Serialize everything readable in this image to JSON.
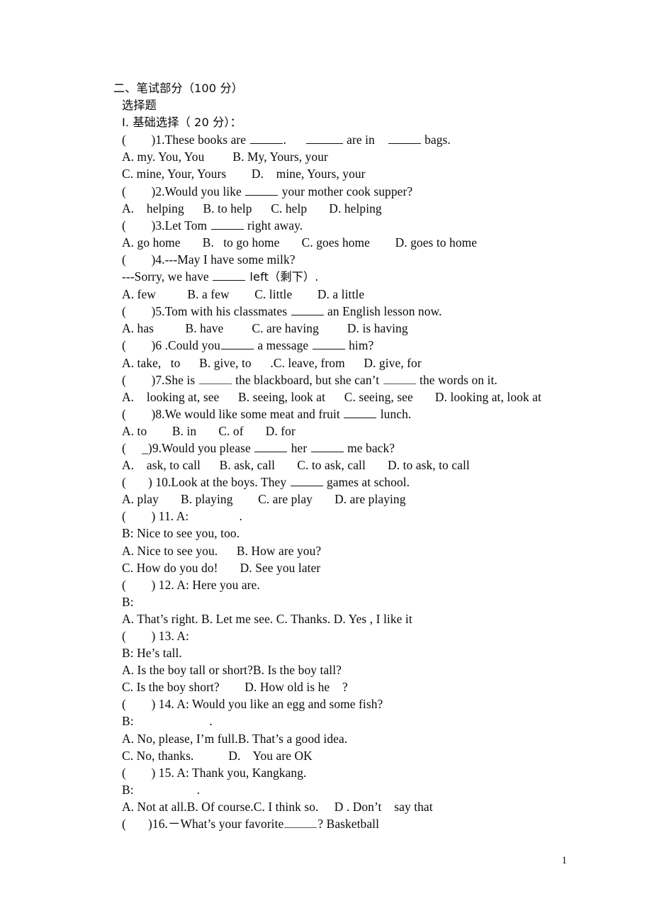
{
  "document": {
    "page_number": "1",
    "section_heading": "二、笔试部分（100 分）",
    "subsection_heading": "选择题",
    "part_heading": "I. 基础选择（ 20 分）：",
    "questions": [
      {
        "stem": "（    ）1.These books are _____.     _____ are in    _____ bags.",
        "stem_prefix": "(        )1.These books are ",
        "stem_mid1": ".      ",
        "stem_mid2": " are in    ",
        "stem_suffix": " bags.",
        "options_lines": [
          "A. my. You, You         B. My, Yours, your",
          "C. mine, Your, Yours        D.    mine, Yours, your"
        ]
      },
      {
        "stem_prefix": "(        )2.Would you like ",
        "stem_suffix": " your mother cook supper?",
        "options_lines": [
          "A.    helping      B. to help      C. help       D. helping"
        ]
      },
      {
        "stem_prefix": "(        )3.Let Tom ",
        "stem_suffix": " right away.",
        "options_lines": [
          "A. go home       B.   to go home       C. goes home        D. goes to home"
        ]
      },
      {
        "stem_prefix": "(        )4.---May I have some milk?",
        "stem_suffix": "",
        "continuation_prefix": "---Sorry, we have ",
        "continuation_suffix": " left（剩下）.",
        "options_lines": [
          "A. few          B. a few        C. little        D. a little"
        ]
      },
      {
        "stem_prefix": "(        )5.Tom with his classmates ",
        "stem_suffix": " an English lesson now.",
        "options_lines": [
          "A. has          B. have         C. are having         D. is having"
        ]
      },
      {
        "stem_prefix": "(        )6 .Could you",
        "stem_mid1": " a message ",
        "stem_suffix": " him?",
        "options_lines": [
          "A. take,   to      B. give, to      .C. leave, from      D. give, for"
        ]
      },
      {
        "stem_prefix": "(        )7.She is ",
        "stem_mid1": " the blackboard, but she can’t ",
        "stem_suffix": " the words on it.",
        "options_lines": [
          "A.    looking at, see      B. seeing, look at      C. seeing, see       D. looking at, look at"
        ]
      },
      {
        "stem_prefix": "(        )8.We would like some meat and fruit ",
        "stem_suffix": " lunch.",
        "options_lines": [
          "A. to        B. in       C. of       D. for"
        ]
      },
      {
        "stem_prefix": "(     _)9.Would you please ",
        "stem_mid1": " her ",
        "stem_suffix": " me back?",
        "options_lines": [
          "A.    ask, to call      B. ask, call       C. to ask, call       D. to ask, to call"
        ]
      },
      {
        "stem_prefix": "(       ) 10.Look at the boys. They ",
        "stem_suffix": " games at school.",
        "options_lines": [
          "A. play       B. playing        C. are play       D. are playing"
        ]
      },
      {
        "stem_prefix": "(        ) 11. A:",
        "stem_suffix": "                .",
        "dialogue_b": "B: Nice to see you, too.",
        "options_lines": [
          "A. Nice to see you.      B. How are you?",
          "C. How do you do!       D. See you later"
        ]
      },
      {
        "stem_prefix": "(        ) 12. A: Here you are.",
        "dialogue_b": "B:",
        "options_lines": [
          "A. That’s right. B. Let me see. C. Thanks. D. Yes , I like it"
        ]
      },
      {
        "stem_prefix": "(        ) 13. A:",
        "dialogue_b": "B: He’s tall.",
        "options_lines": [
          "A. Is the boy tall or short?B. Is the boy tall?",
          "C. Is the boy short?        D. How old is he    ?"
        ]
      },
      {
        "stem_prefix": "(        ) 14. A: Would you like an egg and some fish?",
        "dialogue_b": "B:                        .",
        "options_lines": [
          "A. No, please, I’m full.B. That’s a good idea.",
          "C. No, thanks.           D.    You are OK"
        ]
      },
      {
        "stem_prefix": "(        ) 15. A: Thank you, Kangkang.",
        "dialogue_b": "B:                    .",
        "options_lines": [
          "A. Not at all.B. Of course.C. I think so.     D . Don’t    say that"
        ]
      },
      {
        "stem_prefix": "(       )16.－What’s your favorite",
        "stem_suffix": "? Basketball",
        "options_lines": []
      }
    ]
  }
}
